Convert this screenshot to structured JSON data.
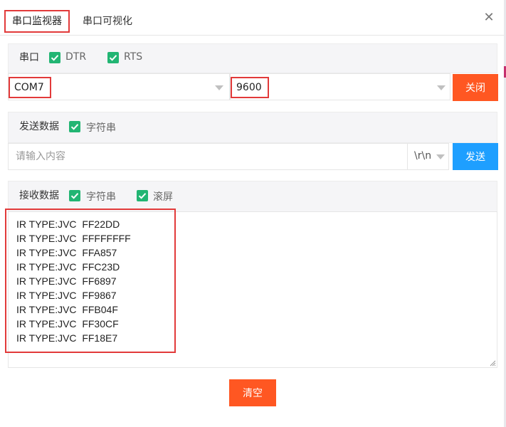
{
  "tabs": [
    {
      "label": "串口监视器"
    },
    {
      "label": "串口可视化"
    }
  ],
  "close_icon": "close-icon",
  "serial": {
    "title": "串口",
    "dtr_label": "DTR",
    "rts_label": "RTS",
    "dtr_checked": true,
    "rts_checked": true,
    "port": "COM7",
    "baud": "9600",
    "close_button": "关闭"
  },
  "send": {
    "title": "发送数据",
    "string_label": "字符串",
    "string_checked": true,
    "placeholder": "请输入内容",
    "line_ending": "\\r\\n",
    "send_button": "发送"
  },
  "receive": {
    "title": "接收数据",
    "string_label": "字符串",
    "scroll_label": "滚屏",
    "lines": [
      "IR TYPE:JVC  FF22DD",
      "IR TYPE:JVC  FFFFFFFF",
      "IR TYPE:JVC  FFA857",
      "IR TYPE:JVC  FFC23D",
      "IR TYPE:JVC  FF6897",
      "IR TYPE:JVC  FF9867",
      "IR TYPE:JVC  FFB04F",
      "IR TYPE:JVC  FF30CF",
      "IR TYPE:JVC  FF18E7"
    ]
  },
  "clear_button": "清空",
  "colors": {
    "accent_orange": "#ff5722",
    "accent_blue": "#1e9fff",
    "check_green": "#22b573",
    "highlight_red": "#e23a3a"
  }
}
